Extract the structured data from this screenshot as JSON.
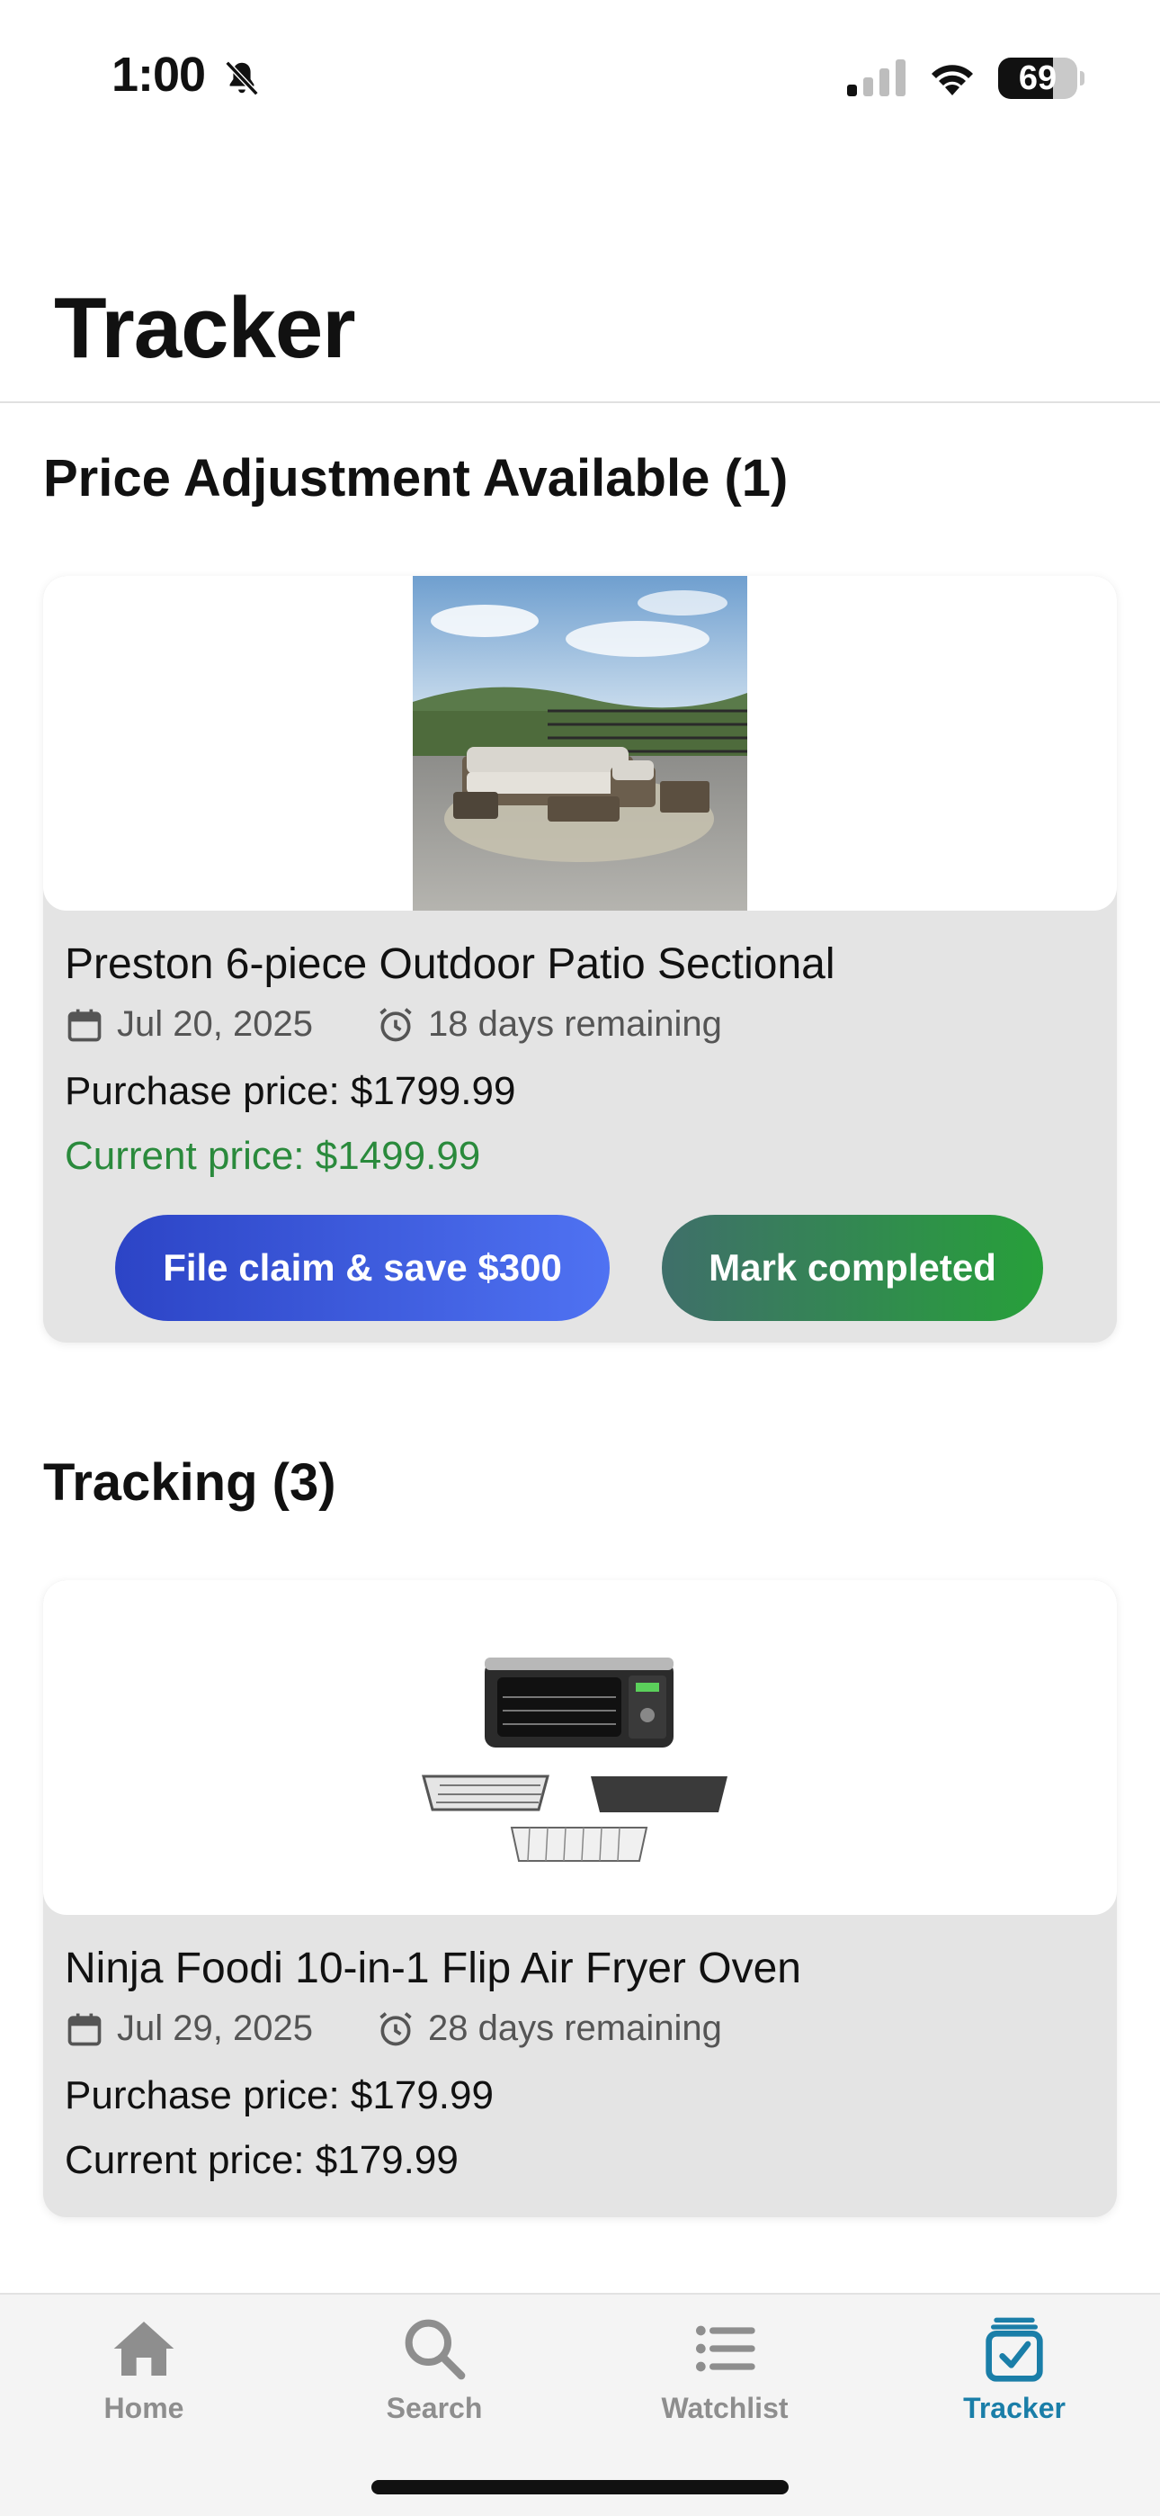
{
  "status_bar": {
    "time": "1:00",
    "battery_level": "69",
    "battery_fraction": 0.69,
    "bell_icon": "bell-slash-icon",
    "signal_icon": "cellular-signal-icon",
    "wifi_icon": "wifi-icon"
  },
  "page": {
    "title": "Tracker"
  },
  "sections": {
    "adjustment_heading": "Price Adjustment Available (1)",
    "tracking_heading": "Tracking (3)"
  },
  "adjustment_items": [
    {
      "name": "Preston 6-piece Outdoor Patio Sectional",
      "date": "Jul 20, 2025",
      "remaining": "18 days remaining",
      "purchase_price": "Purchase price: $1799.99",
      "current_price": "Current price: $1499.99",
      "claim_button": "File claim & save $300",
      "complete_button": "Mark completed",
      "image_icon": "patio-sectional-image"
    }
  ],
  "tracking_items": [
    {
      "name": "Ninja Foodi 10-in-1 Flip Air Fryer Oven",
      "date": "Jul 29, 2025",
      "remaining": "28 days remaining",
      "purchase_price": "Purchase price: $179.99",
      "current_price": "Current price: $179.99",
      "image_icon": "air-fryer-oven-image"
    }
  ],
  "tab_bar": {
    "tabs": [
      {
        "label": "Home",
        "icon": "house-icon",
        "active": false
      },
      {
        "label": "Search",
        "icon": "magnifying-glass-icon",
        "active": false
      },
      {
        "label": "Watchlist",
        "icon": "list-bullet-icon",
        "active": false
      },
      {
        "label": "Tracker",
        "icon": "checklist-box-icon",
        "active": true
      }
    ]
  },
  "colors": {
    "accent": "#1a7ea8",
    "savings_green": "#2a8a3c",
    "claim_button_start": "#2c44c6",
    "claim_button_end": "#4f72f2",
    "complete_button_start": "#3f6f6a",
    "complete_button_end": "#27a03a"
  }
}
